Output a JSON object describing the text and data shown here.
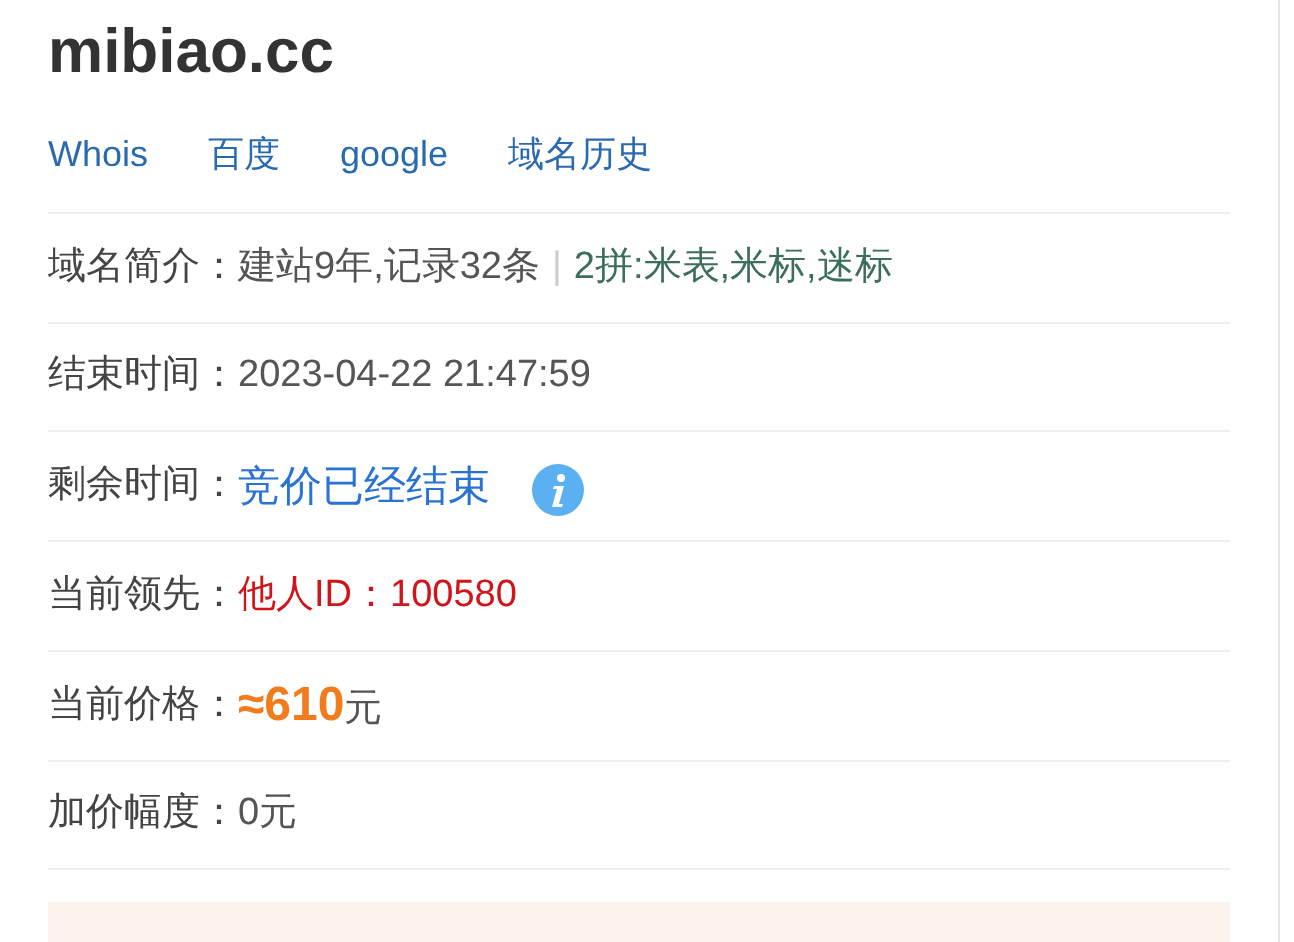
{
  "domain": "mibiao.cc",
  "links": [
    "Whois",
    "百度",
    "google",
    "域名历史"
  ],
  "rows": [
    {
      "kind": "intro",
      "label": "域名简介：",
      "value": "建站9年,记录32条",
      "separator": "|",
      "extra": "2拼:米表,米标,迷标"
    },
    {
      "kind": "plain",
      "label": "结束时间：",
      "value": "2023-04-22 21:47:59"
    },
    {
      "kind": "status",
      "label": "剩余时间：",
      "value": "竞价已经结束"
    },
    {
      "kind": "leader",
      "label": "当前领先：",
      "value": "他人ID：100580"
    },
    {
      "kind": "price",
      "label": "当前价格：",
      "value": "≈610",
      "unit": "元"
    },
    {
      "kind": "plain",
      "label": "加价幅度：",
      "value": "0元"
    }
  ]
}
